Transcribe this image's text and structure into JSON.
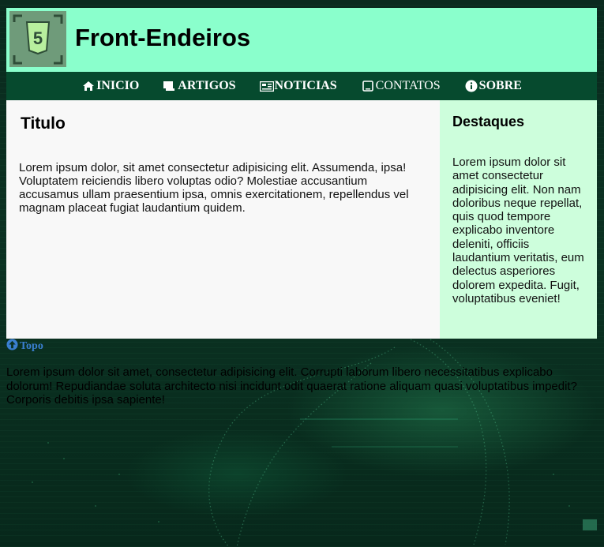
{
  "header": {
    "title": "Front-Endeiros",
    "logo_icon": "html5-logo-icon"
  },
  "nav": {
    "items": [
      {
        "label": "INICIO",
        "icon": "home-icon"
      },
      {
        "label": "ARTIGOS",
        "icon": "scroll-icon"
      },
      {
        "label": "NOTICIAS",
        "icon": "newspaper-icon"
      },
      {
        "label": "CONTATOS",
        "icon": "tablet-icon"
      },
      {
        "label": "SOBRE",
        "icon": "info-icon"
      }
    ]
  },
  "main": {
    "title": "Titulo",
    "body": "Lorem ipsum dolor, sit amet consectetur adipisicing elit. Assumenda, ipsa! Voluptatem reiciendis libero voluptas odio? Molestiae accusantium accusamus ullam praesentium ipsa, omnis exercitationem, repellendus vel magnam placeat fugiat laudantium quidem."
  },
  "aside": {
    "title": "Destaques",
    "body": "Lorem ipsum dolor sit amet consectetur adipisicing elit. Non nam doloribus neque repellat, quis quod tempore explicabo inventore deleniti, officiis laudantium veritatis, eum delectus asperiores dolorem expedita. Fugit, voluptatibus eveniet!"
  },
  "top_link": {
    "label": "Topo",
    "icon": "arrow-up-circle-icon"
  },
  "footer": {
    "text": "Lorem ipsum dolor sit amet, consectetur adipisicing elit. Corrupti laborum libero necessitatibus explicabo dolorum! Repudiandae soluta architecto nisi incidunt odit quaerat ratione aliquam quasi voluptatibus impedit? Corporis debitis ipsa sapiente!"
  },
  "colors": {
    "header_bg": "#8affcc",
    "nav_bg": "#064a2e",
    "main_bg": "#f8f8f8",
    "aside_bg": "#cdfedc",
    "link": "#3a7fd0"
  }
}
